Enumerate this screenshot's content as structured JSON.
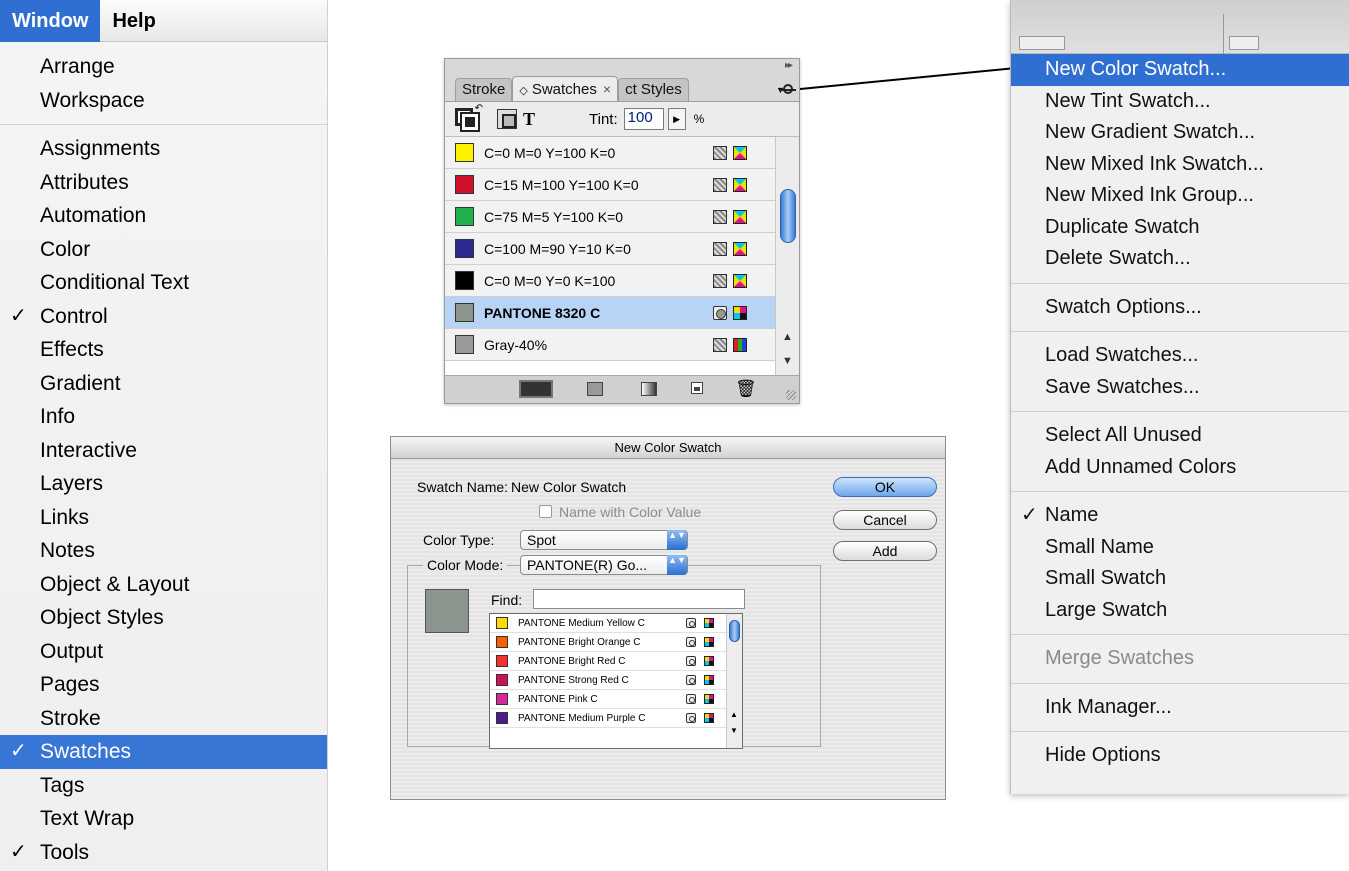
{
  "window_menu": {
    "menubar": {
      "window": "Window",
      "help": "Help"
    },
    "groups": [
      [
        {
          "label": "Arrange",
          "checked": false,
          "selected": false
        },
        {
          "label": "Workspace",
          "checked": false,
          "selected": false
        }
      ],
      [
        {
          "label": "Assignments",
          "checked": false,
          "selected": false
        },
        {
          "label": "Attributes",
          "checked": false,
          "selected": false
        },
        {
          "label": "Automation",
          "checked": false,
          "selected": false
        },
        {
          "label": "Color",
          "checked": false,
          "selected": false
        },
        {
          "label": "Conditional Text",
          "checked": false,
          "selected": false
        },
        {
          "label": "Control",
          "checked": true,
          "selected": false
        },
        {
          "label": "Effects",
          "checked": false,
          "selected": false
        },
        {
          "label": "Gradient",
          "checked": false,
          "selected": false
        },
        {
          "label": "Info",
          "checked": false,
          "selected": false
        },
        {
          "label": "Interactive",
          "checked": false,
          "selected": false
        },
        {
          "label": "Layers",
          "checked": false,
          "selected": false
        },
        {
          "label": "Links",
          "checked": false,
          "selected": false
        },
        {
          "label": "Notes",
          "checked": false,
          "selected": false
        },
        {
          "label": "Object & Layout",
          "checked": false,
          "selected": false
        },
        {
          "label": "Object Styles",
          "checked": false,
          "selected": false
        },
        {
          "label": "Output",
          "checked": false,
          "selected": false
        },
        {
          "label": "Pages",
          "checked": false,
          "selected": false
        },
        {
          "label": "Stroke",
          "checked": false,
          "selected": false
        },
        {
          "label": "Swatches",
          "checked": true,
          "selected": true
        },
        {
          "label": "Tags",
          "checked": false,
          "selected": false
        },
        {
          "label": "Text Wrap",
          "checked": false,
          "selected": false
        },
        {
          "label": "Tools",
          "checked": true,
          "selected": false
        }
      ]
    ],
    "check_glyph": "✓"
  },
  "swatches_panel": {
    "tabs": [
      "Stroke",
      "Swatches",
      "ct Styles"
    ],
    "active_tab_close": "×",
    "tab_glyph": "◇",
    "collapse_glyph": "▸▸",
    "tint_label": "Tint:",
    "tint_value": "100",
    "tint_step": "▶",
    "tint_unit": "%",
    "format_glyph": "T",
    "rows": [
      {
        "name": "C=0 M=0 Y=100 K=0",
        "color": "#fff200",
        "type": "process",
        "mode": "cmyk",
        "selected": false,
        "bold": false
      },
      {
        "name": "C=15 M=100 Y=100 K=0",
        "color": "#d0112b",
        "type": "process",
        "mode": "cmyk",
        "selected": false,
        "bold": false
      },
      {
        "name": "C=75 M=5 Y=100 K=0",
        "color": "#21b24b",
        "type": "process",
        "mode": "cmyk",
        "selected": false,
        "bold": false
      },
      {
        "name": "C=100 M=90 Y=10 K=0",
        "color": "#2d2a8e",
        "type": "process",
        "mode": "cmyk",
        "selected": false,
        "bold": false
      },
      {
        "name": "C=0 M=0 Y=0 K=100",
        "color": "#000000",
        "type": "process",
        "mode": "cmyk",
        "selected": false,
        "bold": false
      },
      {
        "name": "PANTONE 8320 C",
        "color": "#8b948d",
        "type": "spot",
        "mode": "quad",
        "selected": true,
        "bold": true
      },
      {
        "name": "Gray-40%",
        "color": "#999999",
        "type": "process",
        "mode": "rgb",
        "selected": false,
        "bold": false
      }
    ],
    "scroll_up": "▲",
    "scroll_down": "▼",
    "trash_glyph": "🗑"
  },
  "flyout_menu": {
    "groups": [
      [
        {
          "label": "New Color Swatch...",
          "selected": true
        },
        {
          "label": "New Tint Swatch..."
        },
        {
          "label": "New Gradient Swatch..."
        },
        {
          "label": "New Mixed Ink Swatch..."
        },
        {
          "label": "New Mixed Ink Group..."
        },
        {
          "label": "Duplicate Swatch"
        },
        {
          "label": "Delete Swatch..."
        }
      ],
      [
        {
          "label": "Swatch Options..."
        }
      ],
      [
        {
          "label": "Load Swatches..."
        },
        {
          "label": "Save Swatches..."
        }
      ],
      [
        {
          "label": "Select All Unused"
        },
        {
          "label": "Add Unnamed Colors"
        }
      ],
      [
        {
          "label": "Name",
          "checked": true
        },
        {
          "label": "Small Name"
        },
        {
          "label": "Small Swatch"
        },
        {
          "label": "Large Swatch"
        }
      ],
      [
        {
          "label": "Merge Swatches",
          "disabled": true
        }
      ],
      [
        {
          "label": "Ink Manager..."
        }
      ],
      [
        {
          "label": "Hide Options"
        }
      ]
    ]
  },
  "dialog": {
    "title": "New Color Swatch",
    "swatch_name_label": "Swatch Name:",
    "swatch_name_value": "New Color Swatch",
    "name_with_color_value": "Name with Color Value",
    "color_type_label": "Color Type:",
    "color_type_value": "Spot",
    "color_mode_label": "Color Mode:",
    "color_mode_value": "PANTONE(R) Go...",
    "find_label": "Find:",
    "find_value": "",
    "ok": "OK",
    "cancel": "Cancel",
    "add": "Add",
    "select_arrow": "▲▼",
    "scroll_up": "▲",
    "scroll_down": "▼",
    "preview_color": "#8b958e",
    "pantone_rows": [
      {
        "name": "PANTONE Medium Yellow C",
        "color": "#ffd800"
      },
      {
        "name": "PANTONE Bright Orange C",
        "color": "#ff5f00"
      },
      {
        "name": "PANTONE Bright Red C",
        "color": "#f2302c"
      },
      {
        "name": "PANTONE Strong Red C",
        "color": "#d0105a"
      },
      {
        "name": "PANTONE Pink C",
        "color": "#d8269b"
      },
      {
        "name": "PANTONE Medium Purple C",
        "color": "#4f1b8f"
      }
    ]
  }
}
